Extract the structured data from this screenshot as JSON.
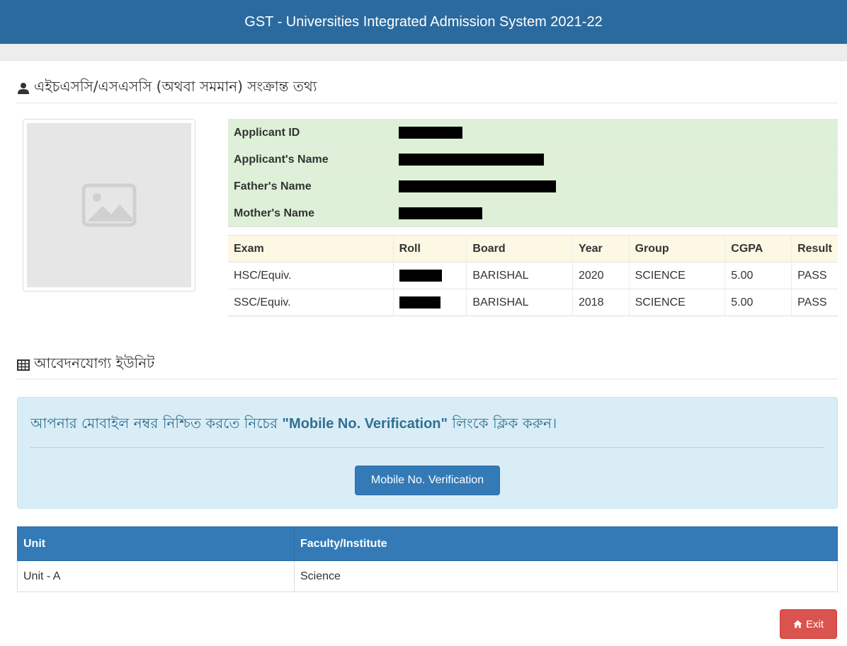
{
  "header": {
    "title": "GST - Universities Integrated Admission System 2021-22"
  },
  "section1": {
    "title": "এইচএসসি/এসএসসি (অথবা সমমান) সংক্রান্ত তথ্য",
    "icon": "user-icon"
  },
  "applicant": {
    "fields": [
      {
        "label": "Applicant ID"
      },
      {
        "label": "Applicant's Name"
      },
      {
        "label": "Father's Name"
      },
      {
        "label": "Mother's Name"
      }
    ]
  },
  "exam_table": {
    "headers": [
      "Exam",
      "Roll",
      "Board",
      "Year",
      "Group",
      "CGPA",
      "Result"
    ],
    "rows": [
      {
        "exam": "HSC/Equiv.",
        "board": "BARISHAL",
        "year": "2020",
        "group": "SCIENCE",
        "cgpa": "5.00",
        "result": "PASS"
      },
      {
        "exam": "SSC/Equiv.",
        "board": "BARISHAL",
        "year": "2018",
        "group": "SCIENCE",
        "cgpa": "5.00",
        "result": "PASS"
      }
    ]
  },
  "section2": {
    "title": "আবেদনযোগ্য ইউনিট",
    "icon": "table-icon"
  },
  "alert": {
    "text_before": "আপনার মোবাইল নম্বর নিশ্চিত করতে নিচের ",
    "text_bold": "\"Mobile No. Verification\"",
    "text_after": " লিংকে ক্লিক করুন।",
    "button_label": "Mobile No. Verification"
  },
  "unit_table": {
    "headers": [
      "Unit",
      "Faculty/Institute"
    ],
    "rows": [
      {
        "unit": "Unit - A",
        "faculty": "Science"
      }
    ]
  },
  "exit_button": {
    "label": "Exit",
    "icon": "home-icon"
  },
  "colors": {
    "header": "#2b6a9e",
    "primary": "#337ab7",
    "danger": "#d9534f",
    "info_bg": "#d9edf7",
    "success_bg": "#dff0d8",
    "warning_bg": "#fcf8e3"
  }
}
